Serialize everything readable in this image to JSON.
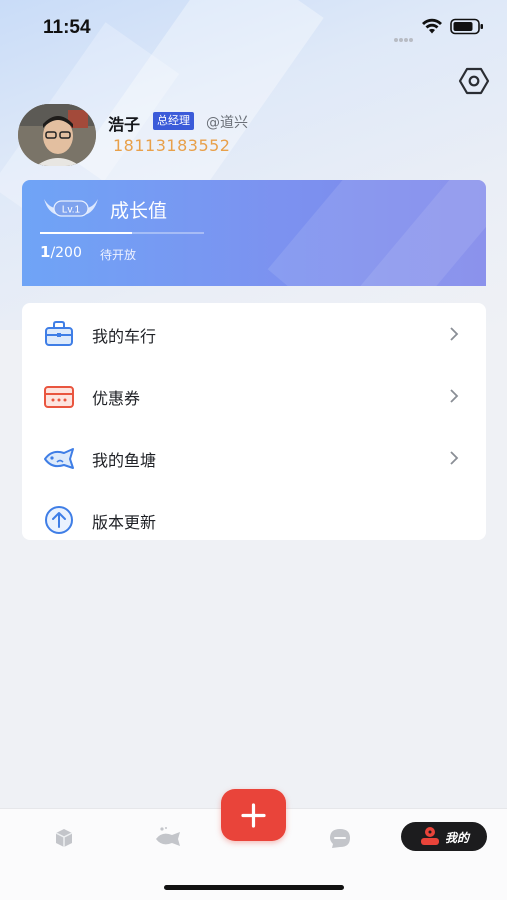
{
  "status_bar": {
    "time": "11:54"
  },
  "profile": {
    "name": "浩子",
    "role": "总经理",
    "handle": "@道兴",
    "phone": "18113183552"
  },
  "growth": {
    "level": "Lv.1",
    "title": "成长值",
    "current": "1",
    "total": "/200",
    "progress_fraction": 0.005,
    "status": "待开放"
  },
  "menu": {
    "items": [
      {
        "label": "我的车行",
        "icon": "briefcase-icon",
        "has_arrow": true
      },
      {
        "label": "优惠券",
        "icon": "coupon-icon",
        "has_arrow": true
      },
      {
        "label": "我的鱼塘",
        "icon": "fish-icon",
        "has_arrow": true
      },
      {
        "label": "版本更新",
        "icon": "upload-arrow-icon",
        "has_arrow": false
      }
    ]
  },
  "tab_bar": {
    "mine_label": "我的",
    "add_icon": "plus-icon"
  },
  "colors": {
    "accent_red": "#e9443a",
    "badge_blue": "#3b5bd9",
    "phone_orange": "#e8a04a",
    "card_gradient_start": "#6fa4f6",
    "card_gradient_end": "#7e86ea"
  }
}
